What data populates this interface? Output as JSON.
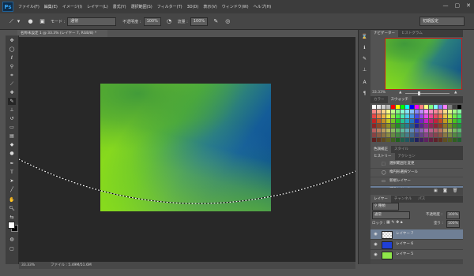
{
  "app": {
    "logo": "Ps"
  },
  "menubar": {
    "items": [
      "ファイル(F)",
      "編集(E)",
      "イメージ(I)",
      "レイヤー(L)",
      "書式(Y)",
      "選択範囲(S)",
      "フィルター(T)",
      "3D(D)",
      "表示(V)",
      "ウィンドウ(W)",
      "ヘルプ(H)"
    ],
    "window_controls": [
      "—",
      "▢",
      "✕"
    ]
  },
  "options_bar": {
    "mode_label": "モード :",
    "mode_value": "通常",
    "opacity_label": "不透明度 :",
    "opacity_value": "100%",
    "flow_label": "流量 :",
    "flow_value": "100%",
    "workspace": "初期設定"
  },
  "document": {
    "tab_title": "名称未設定 1 @ 33.3% (レイヤー 7, RGB/8) *",
    "status_zoom": "33.33%",
    "status_file": "ファイル : 5.49M/51.6M"
  },
  "panels": {
    "navigator_tabs": [
      "ナビゲーター",
      "ヒストグラム"
    ],
    "navigator_zoom": "33.33%",
    "swatch_tabs": [
      "カラー",
      "スウォッチ"
    ],
    "history_tabs": [
      "ヒストリー",
      "アクション"
    ],
    "history_top_tabs": [
      "色調補正",
      "スタイル"
    ],
    "history_items": [
      "選択範囲を変更",
      "楕円形選択ツール",
      "新規レイヤー",
      "ブラシツール"
    ],
    "layers_tabs": [
      "レイヤー",
      "チャンネル",
      "パス"
    ],
    "layers_kind": "種類",
    "blend_mode": "通常",
    "opacity_label": "不透明度 :",
    "opacity_value": "100%",
    "lock_label": "ロック :",
    "fill_label": "塗り :",
    "fill_value": "100%",
    "layers": [
      "レイヤー 7",
      "レイヤー 6",
      "レイヤー 5"
    ]
  },
  "colors": {
    "accent": "#6b7f9a",
    "nav_frame": "#c51b1b",
    "layer6_thumb": "#1f3fd6",
    "layer5_thumb": "#8fe64a"
  }
}
